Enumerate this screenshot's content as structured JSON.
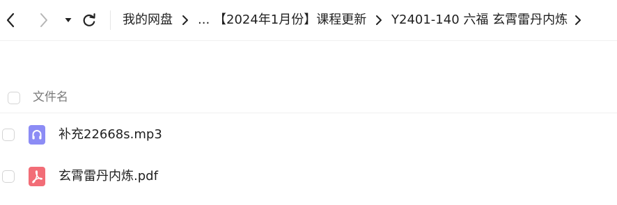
{
  "nav": {
    "back_icon": "chevron-left-icon",
    "forward_icon": "chevron-right-icon",
    "history_icon": "caret-down-icon",
    "refresh_icon": "refresh-icon"
  },
  "breadcrumb": {
    "items": [
      {
        "label": "我的网盘"
      },
      {
        "label": "..."
      },
      {
        "label": "【2024年1月份】课程更新"
      },
      {
        "label": "Y2401-140 六福 玄霄雷丹内炼"
      }
    ],
    "separator_icon": "chevron-right-icon"
  },
  "list": {
    "header_label": "文件名",
    "files": [
      {
        "name": "补充22668s.mp3",
        "icon": "audio-file-icon",
        "icon_color": "#8c8cf5"
      },
      {
        "name": "玄霄雷丹内炼.pdf",
        "icon": "pdf-file-icon",
        "icon_color": "#f26d77"
      }
    ]
  },
  "colors": {
    "text": "#1f1f1f",
    "muted_text": "#7a7a7a",
    "border": "#f0f0f0",
    "icon_dark": "#222222",
    "icon_disabled": "#b5b5b5"
  }
}
